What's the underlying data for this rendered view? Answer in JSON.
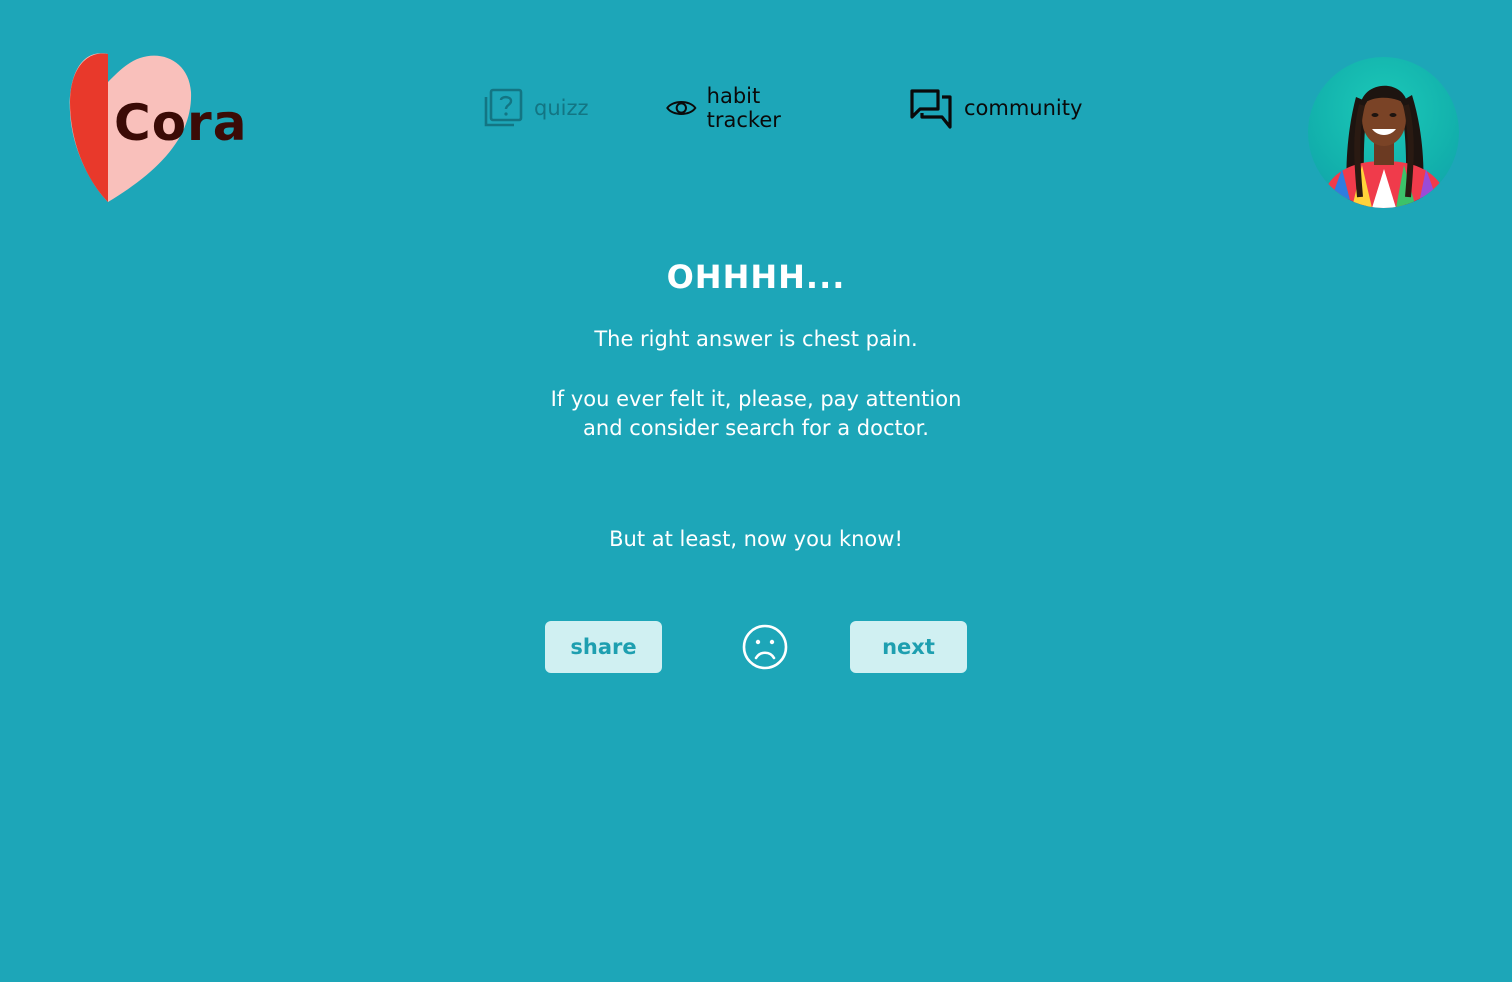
{
  "brand": {
    "name": "Cora",
    "heart_left_color": "#e8392b",
    "heart_right_color": "#f9c0bb",
    "text_color": "#3b0b06"
  },
  "nav": {
    "quizz": {
      "label": "quizz",
      "icon": "quiz-question-icon"
    },
    "habit": {
      "label": "habit tracker",
      "icon": "eye-icon"
    },
    "community": {
      "label": "community",
      "icon": "chat-bubbles-icon"
    }
  },
  "profile": {
    "icon": "user-avatar"
  },
  "result": {
    "title": "OHHHH...",
    "answer": "The right answer is chest pain.",
    "advice_line1": "If you ever felt it, please, pay attention",
    "advice_line2": "and consider search for a doctor.",
    "closing": "But at least, now you know!",
    "mood_icon": "sad-face-icon"
  },
  "actions": {
    "share_label": "share",
    "next_label": "next"
  },
  "colors": {
    "background": "#1da6b8",
    "button_bg": "#d0f0f2",
    "button_text": "#1e9fb0",
    "active_nav": "#137583"
  }
}
